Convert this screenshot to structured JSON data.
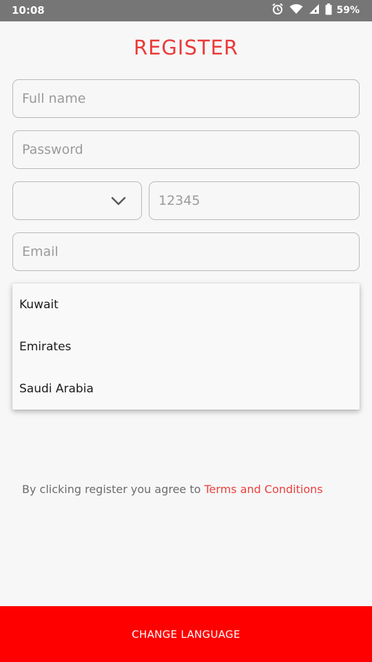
{
  "status_bar": {
    "time": "10:08",
    "battery_percent": "59%",
    "icons": [
      "alarm-icon",
      "wifi-icon",
      "cell-signal-icon",
      "battery-icon"
    ]
  },
  "title": "REGISTER",
  "form": {
    "full_name_placeholder": "Full name",
    "password_placeholder": "Password",
    "country_code_value": "",
    "phone_placeholder": "12345",
    "email_placeholder": "Email"
  },
  "country_dropdown": {
    "options": [
      "Kuwait",
      "Emirates",
      "Saudi Arabia"
    ]
  },
  "terms": {
    "prefix": "By clicking register you agree to",
    "link": "Terms and Conditions"
  },
  "bottom_button": {
    "label": "CHANGE LANGUAGE"
  },
  "colors": {
    "accent": "#ea3a38",
    "bottom_button": "#ff0000",
    "status_bar": "#767676",
    "background": "#f7f7f7"
  }
}
